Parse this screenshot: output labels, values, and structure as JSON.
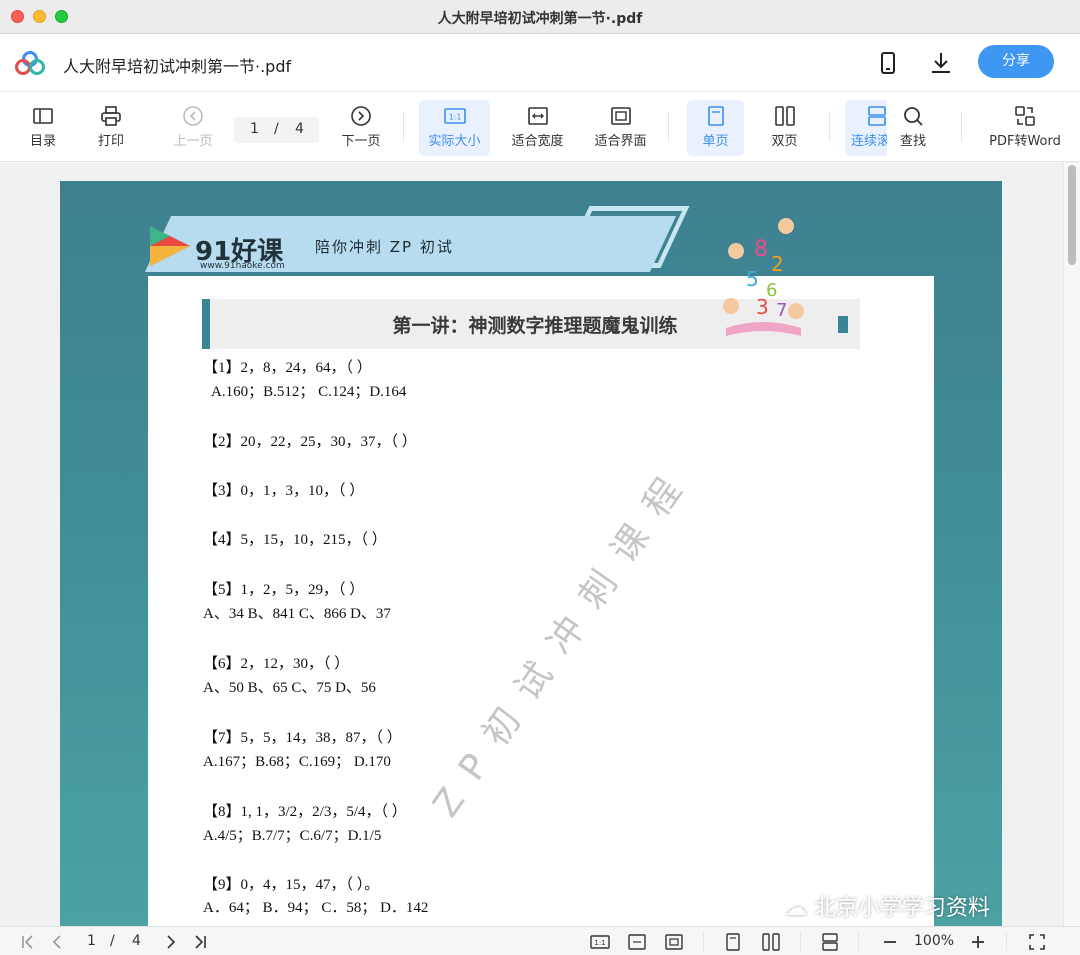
{
  "window": {
    "title": "人大附早培初试冲刺第一节·.pdf"
  },
  "header": {
    "doc_title": "人大附早培初试冲刺第一节·.pdf",
    "share_label": "分享"
  },
  "toolbar": {
    "toc": "目录",
    "print": "打印",
    "prev": "上一页",
    "page_current": "1",
    "page_sep": "/",
    "page_total": "4",
    "next": "下一页",
    "actual_size": "实际大小",
    "fit_width": "适合宽度",
    "fit_window": "适合界面",
    "single_page": "单页",
    "double_page": "双页",
    "continuous": "连续滚",
    "find": "查找",
    "pdf_to_word": "PDF转Word"
  },
  "pdf": {
    "brand": "91好课",
    "brand_url": "www.91haoke.com",
    "brand_tagline": "陪你冲刺 ZP 初试",
    "heading": "第一讲：神测数字推理题魔鬼训练",
    "questions": [
      {
        "q": "【1】2，8，24，64，（  ）",
        "a": "A.160；B.512；  C.124；D.164"
      },
      {
        "q": "【2】20，22，25，30，37，（  ）",
        "a": ""
      },
      {
        "q": "【3】0，1，3，10，（  ）",
        "a": ""
      },
      {
        "q": "【4】5，15，10，215，（  ）",
        "a": ""
      },
      {
        "q": "【5】1，2，5，29，（  ）",
        "a": "A、34 B、841 C、866 D、37"
      },
      {
        "q": "【6】2，12，30，（  ）",
        "a": "A、50 B、65 C、75 D、56"
      },
      {
        "q": "【7】5，5，14，38，87，（  ）",
        "a": "A.167；B.68；C.169；   D.170"
      },
      {
        "q": "【8】1, 1，3/2，2/3，5/4，（  ）",
        "a": "A.4/5；B.7/7；C.6/7；D.1/5"
      },
      {
        "q": "【9】0，4，15，47，（  ）。",
        "a": "A．64；   B．94；   C．58；   D．142"
      }
    ],
    "watermark": "ZP初试冲刺课程"
  },
  "overlay": {
    "wechat_label": "北京小学学习资料"
  },
  "bottombar": {
    "page_current": "1",
    "page_sep": "/",
    "page_total": "4",
    "zoom": "100%"
  }
}
